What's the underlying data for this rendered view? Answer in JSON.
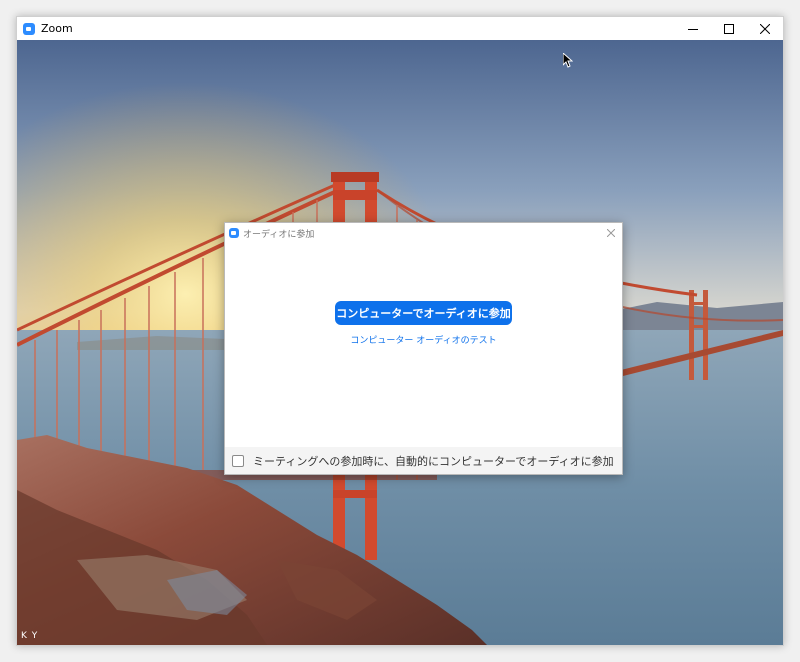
{
  "window": {
    "title": "Zoom",
    "icon": "zoom-camera-icon",
    "controls": {
      "minimize": "minimize-icon",
      "maximize": "maximize-icon",
      "close": "close-icon"
    }
  },
  "video": {
    "participant_initials": "K Y"
  },
  "audio_dialog": {
    "title": "オーディオに参加",
    "join_button": "コンピューターでオーディオに参加",
    "test_link": "コンピューター オーディオのテスト",
    "auto_join_checkbox": {
      "label": "ミーティングへの参加時に、自動的にコンピューターでオーディオに参加",
      "checked": false
    }
  },
  "colors": {
    "accent": "#0e71eb",
    "zoom_icon": "#2d8cff"
  }
}
